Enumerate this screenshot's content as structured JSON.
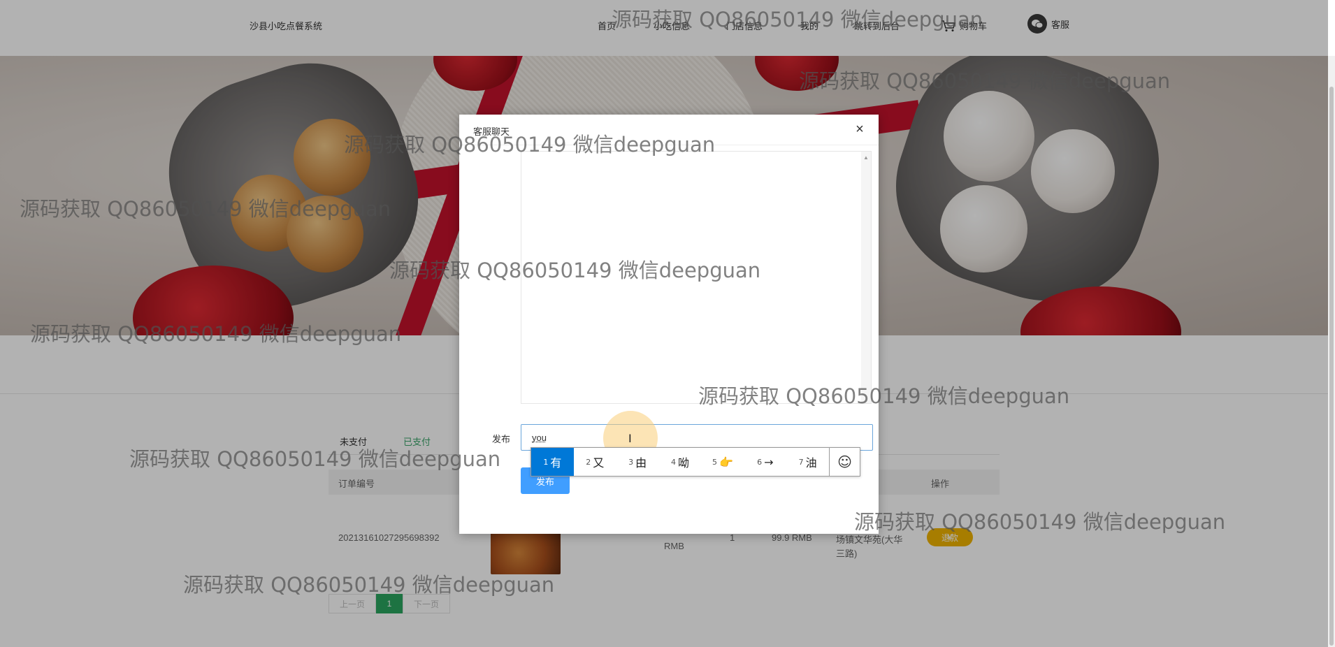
{
  "navbar": {
    "brand": "沙县小吃点餐系统",
    "links": [
      "首页",
      "小吃信息",
      "门店信息",
      "我的",
      "跳转到后台"
    ],
    "cart_label": "购物车",
    "service_label": "客服"
  },
  "orders": {
    "tabs": [
      "未支付",
      "已支付"
    ],
    "columns": {
      "order_no": "订单编号",
      "action": "操作"
    },
    "row": {
      "order_no": "20213161027295698392",
      "currency": "RMB",
      "quantity": "1",
      "total": "99.9 RMB",
      "address_line1": "场镇文华苑(大华",
      "address_line2": "三路)",
      "refund_label": "退款"
    },
    "pager": {
      "prev": "上一页",
      "current": "1",
      "next": "下一页"
    }
  },
  "dialog": {
    "title": "客服聊天",
    "close": "×",
    "publish_label": "发布",
    "input_value": "you",
    "publish_button": "发布"
  },
  "ime": {
    "candidates": [
      {
        "n": "1",
        "text": "有"
      },
      {
        "n": "2",
        "text": "又"
      },
      {
        "n": "3",
        "text": "由"
      },
      {
        "n": "4",
        "text": "呦"
      },
      {
        "n": "5",
        "text": "👉"
      },
      {
        "n": "6",
        "text": "→"
      },
      {
        "n": "7",
        "text": "油"
      }
    ],
    "emoji": "☺"
  },
  "watermark": "源码获取 QQ86050149 微信deepguan",
  "colors": {
    "primary": "#409eff",
    "paid": "#3ca56b",
    "pager_active": "#2aa55f",
    "refund": "#f0b300",
    "ime_selected": "#0078d7"
  }
}
